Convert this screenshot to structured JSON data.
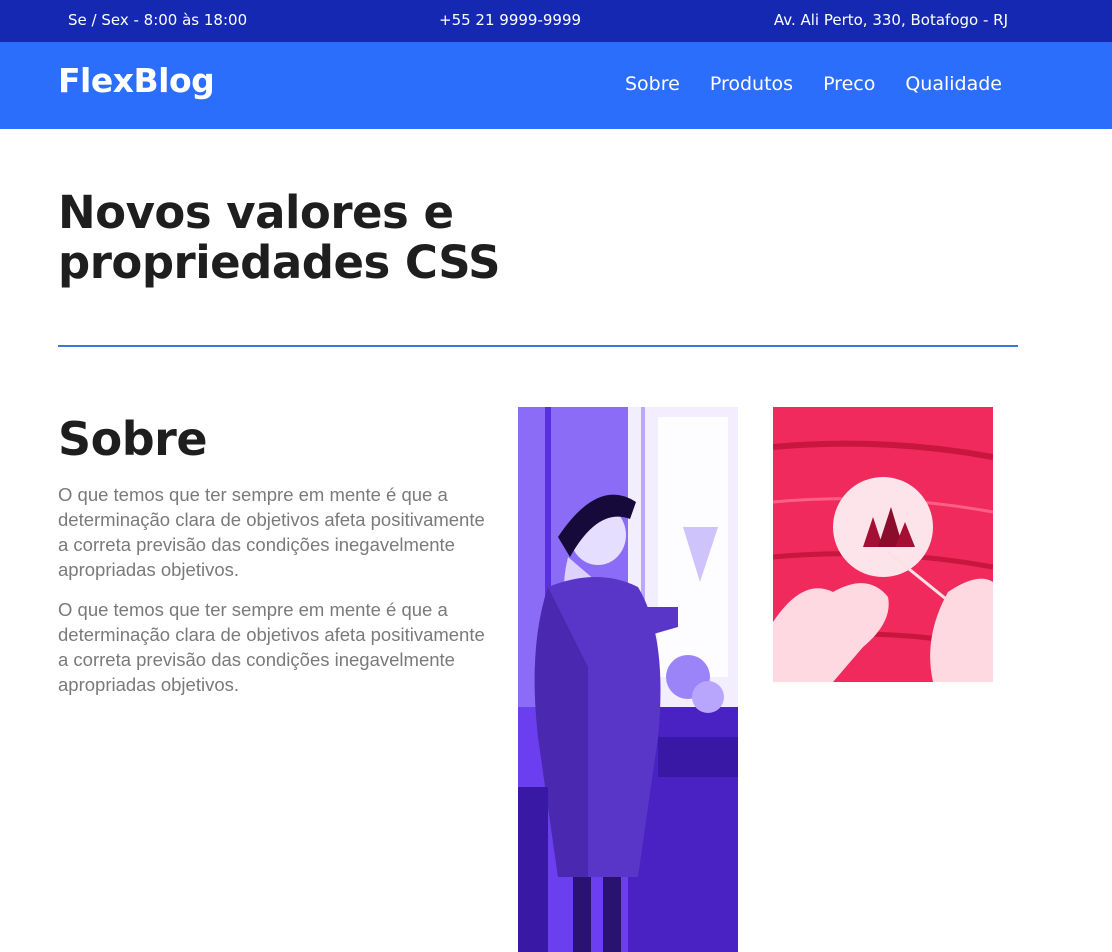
{
  "topbar": {
    "hours": "Se / Sex - 8:00 às 18:00",
    "phone": "+55 21 9999-9999",
    "address": "Av. Ali Perto, 330, Botafogo - RJ"
  },
  "header": {
    "logo": "FlexBlog",
    "nav": [
      {
        "label": "Sobre"
      },
      {
        "label": "Produtos"
      },
      {
        "label": "Preco"
      },
      {
        "label": "Qualidade"
      }
    ]
  },
  "hero": {
    "title": "Novos valores e propriedades CSS"
  },
  "about": {
    "title": "Sobre",
    "paragraphs": [
      "O que temos que ter sempre em mente é que a determinação clara de objetivos afeta positivamente a correta previsão das condições inegavelmente apropriadas objetivos.",
      "O que temos que ter sempre em mente é que a determinação clara de objetivos afeta positivamente a correta previsão das condições inegavelmente apropriadas objetivos."
    ]
  },
  "images": {
    "woman_photo": "woman-with-hat-purple-photo",
    "hands_photo": "hands-painting-red-photo"
  },
  "colors": {
    "topbar": "#1428b2",
    "navbar": "#2b6efc",
    "divider": "#3a78d8",
    "photo_purple": "#6a3cf2",
    "photo_red": "#f02a5c"
  }
}
